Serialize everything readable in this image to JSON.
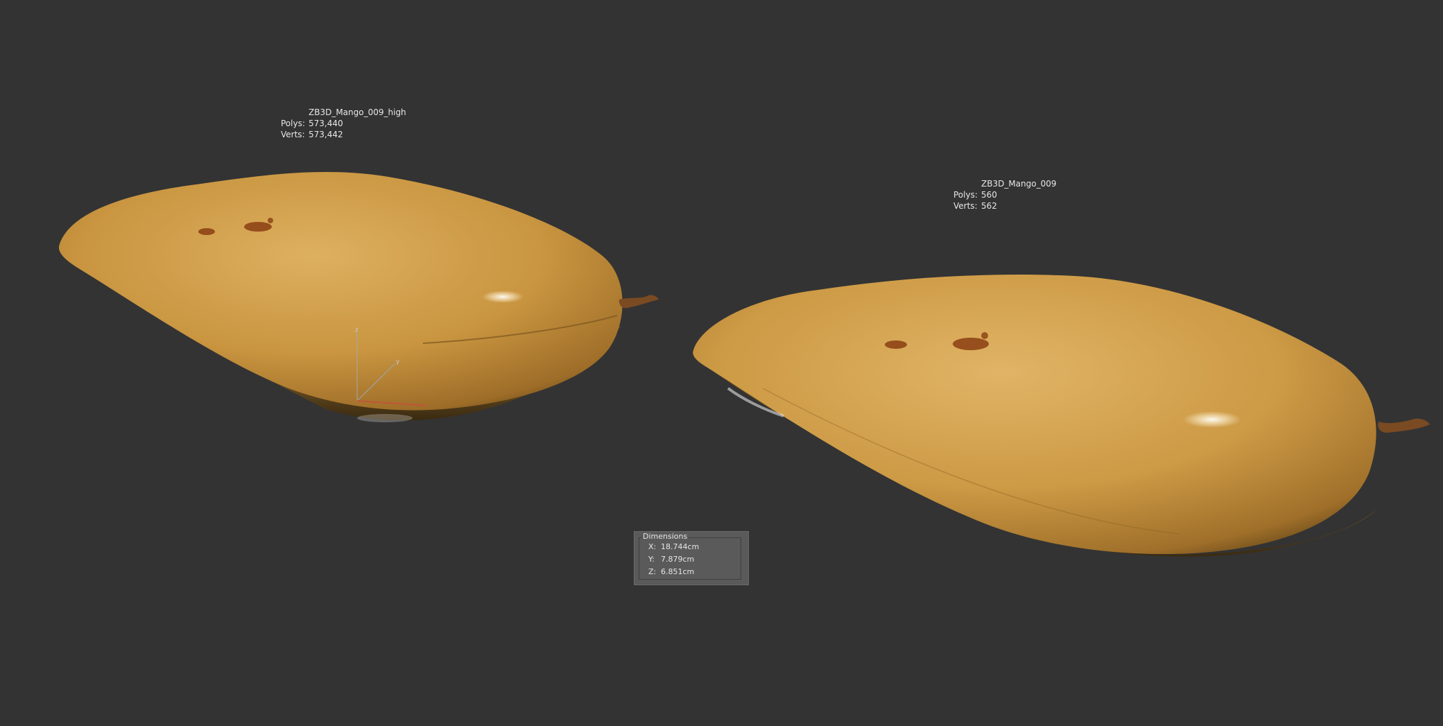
{
  "viewport": {
    "background": "#333333"
  },
  "models": [
    {
      "name": "ZB3D_Mango_009_high",
      "polys_label": "Polys:",
      "polys": "573,440",
      "verts_label": "Verts:",
      "verts": "573,442"
    },
    {
      "name": "ZB3D_Mango_009",
      "polys_label": "Polys:",
      "polys": "560",
      "verts_label": "Verts:",
      "verts": "562"
    }
  ],
  "gizmo": {
    "z_label": "z",
    "y_label": "y"
  },
  "dimensions": {
    "title": "Dimensions",
    "rows": [
      {
        "axis": "X:",
        "value": "18.744cm"
      },
      {
        "axis": "Y:",
        "value": "7.879cm"
      },
      {
        "axis": "Z:",
        "value": "6.851cm"
      }
    ]
  },
  "colors": {
    "mango_skin": "#c9953f",
    "mango_highlight": "#e2b563",
    "mango_shadow": "#6e4c1c",
    "stem": "#7a4a22",
    "spot": "#8a3e12",
    "panel": "#5a5a5a",
    "text": "#e8e8e8"
  }
}
